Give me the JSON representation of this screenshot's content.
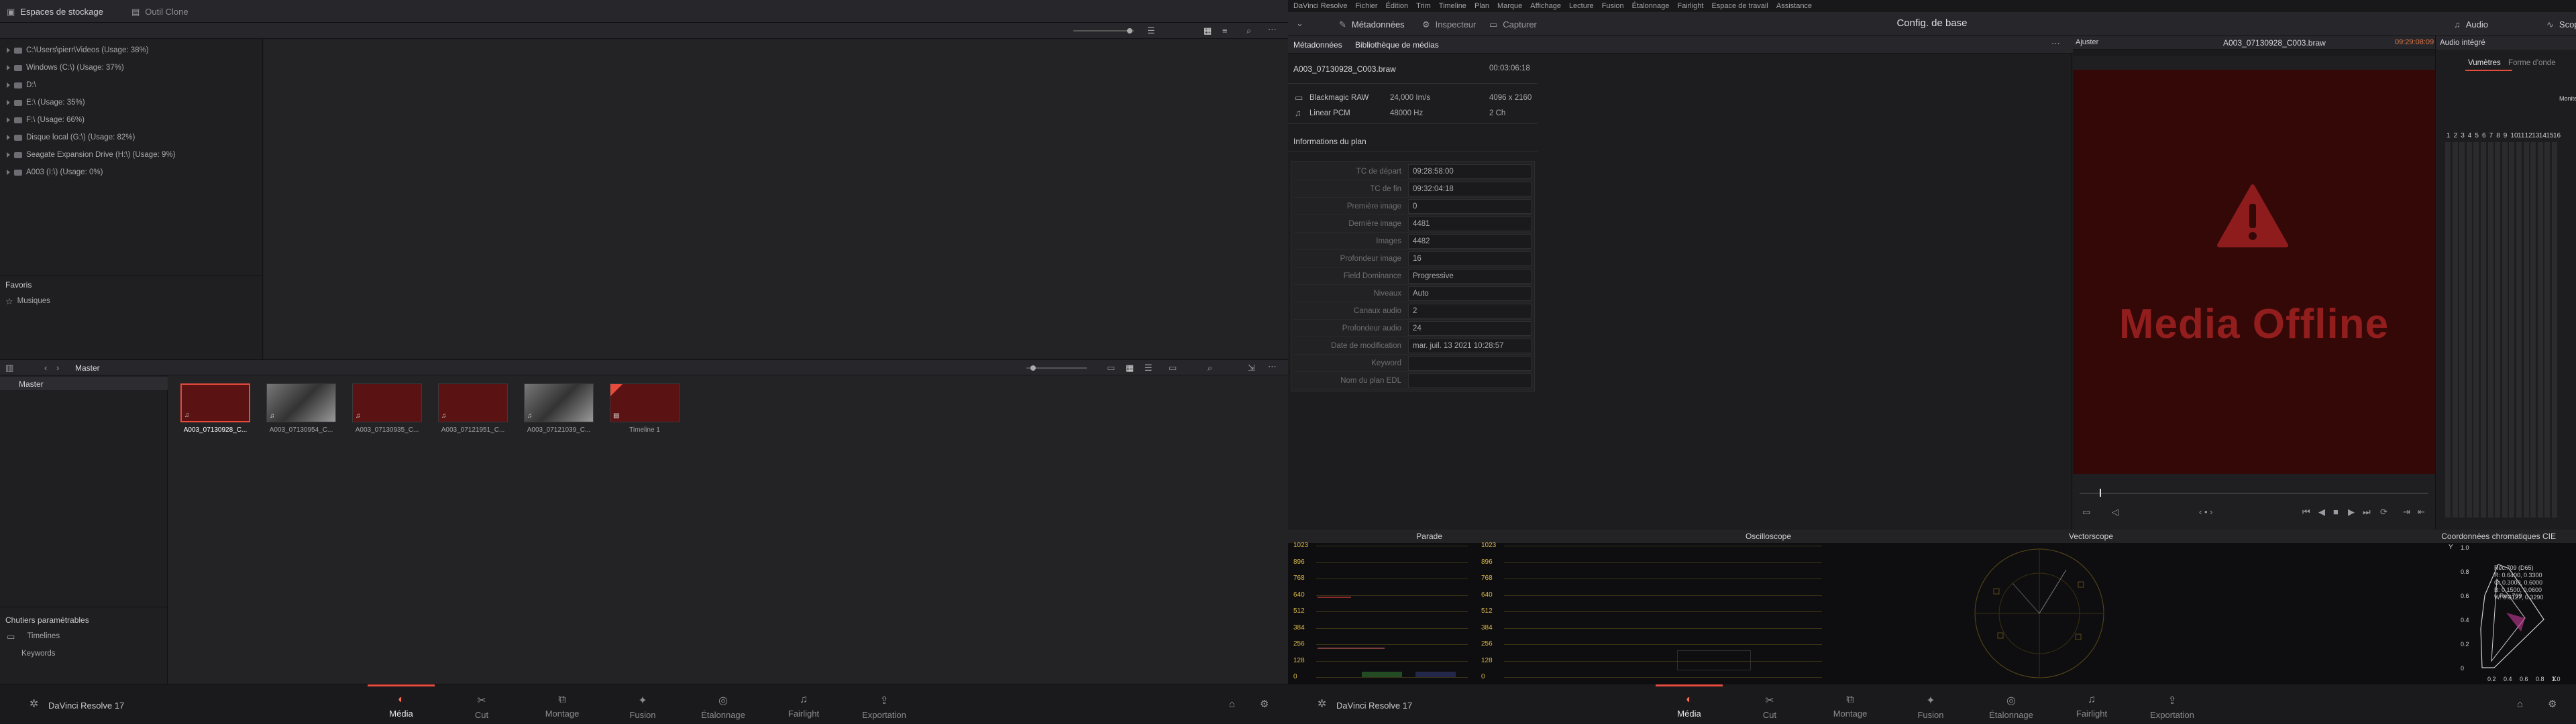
{
  "left_window": {
    "topbar": {
      "storage_tab": "Espaces de stockage",
      "clone_tab": "Outil Clone"
    },
    "storage": {
      "items": [
        "C:\\Users\\pierr\\Videos (Usage: 38%)",
        "Windows (C:\\) (Usage: 37%)",
        "D:\\",
        "E:\\ (Usage: 35%)",
        "F:\\ (Usage: 66%)",
        "Disque local (G:\\) (Usage: 82%)",
        "Seagate Expansion Drive (H:\\) (Usage: 9%)",
        "A003 (I:\\) (Usage: 0%)"
      ]
    },
    "favorites": {
      "title": "Favoris",
      "items": [
        "Musiques"
      ]
    },
    "bin": {
      "title": "Master",
      "master_label": "Master"
    },
    "clips": [
      {
        "label": "A003_07130928_C...",
        "kind": "red",
        "selected": true
      },
      {
        "label": "A003_07130954_C...",
        "kind": "gray",
        "selected": false
      },
      {
        "label": "A003_07130935_C...",
        "kind": "red",
        "selected": false
      },
      {
        "label": "A003_07121951_C...",
        "kind": "red",
        "selected": false
      },
      {
        "label": "A003_07121039_C...",
        "kind": "gray",
        "selected": false
      },
      {
        "label": "Timeline 1",
        "kind": "timeline",
        "selected": false
      }
    ],
    "smart_bins": {
      "title": "Chutiers paramétrables",
      "items": [
        "Timelines",
        "Keywords"
      ]
    },
    "app_name": "DaVinci Resolve 17",
    "pages": [
      "Média",
      "Cut",
      "Montage",
      "Fusion",
      "Étalonnage",
      "Fairlight",
      "Exportation"
    ],
    "active_page": "Média"
  },
  "right_window": {
    "menu": [
      "DaVinci Resolve",
      "Fichier",
      "Édition",
      "Trim",
      "Timeline",
      "Plan",
      "Marque",
      "Affichage",
      "Lecture",
      "Fusion",
      "Étalonnage",
      "Fairlight",
      "Espace de travail",
      "Assistance"
    ],
    "toolbar": {
      "metadata": "Métadonnées",
      "inspector": "Inspecteur",
      "capture": "Capturer",
      "title": "Config. de base",
      "audio": "Audio",
      "scopes": "Scopes"
    },
    "metadata_panel": {
      "tab_metadata": "Métadonnées",
      "tab_library": "Bibliothèque de médias",
      "clip_name": "A003_07130928_C003.braw",
      "duration": "00:03:06:18",
      "video_codec": "Blackmagic RAW",
      "fps": "24,000 Im/s",
      "resolution": "4096 x 2160",
      "audio_codec": "Linear PCM",
      "sample_rate": "48000 Hz",
      "channels": "2 Ch",
      "section": "Informations du plan",
      "fields": [
        {
          "k": "TC de départ",
          "v": "09:28:58:00"
        },
        {
          "k": "TC de fin",
          "v": "09:32:04:18"
        },
        {
          "k": "Première image",
          "v": "0"
        },
        {
          "k": "Dernière image",
          "v": "4481"
        },
        {
          "k": "Images",
          "v": "4482"
        },
        {
          "k": "Profondeur image",
          "v": "16"
        },
        {
          "k": "Field Dominance",
          "v": "Progressive"
        },
        {
          "k": "Niveaux",
          "v": "Auto"
        },
        {
          "k": "Canaux audio",
          "v": "2"
        },
        {
          "k": "Profondeur audio",
          "v": "24"
        },
        {
          "k": "Date de modification",
          "v": "mar. juil. 13 2021 10:28:57"
        },
        {
          "k": "Keyword",
          "v": ""
        },
        {
          "k": "Nom du plan EDL",
          "v": ""
        }
      ]
    },
    "viewer": {
      "fit": "Ajuster",
      "clip": "A003_07130928_C003.braw",
      "timecode": "09:29:08:09",
      "offline_text": "Media Offline"
    },
    "audio_panel": {
      "title": "Audio intégré",
      "tab_meters": "Vumètres",
      "tab_waveform": "Forme d'onde",
      "monitor": "Moniteur",
      "channels": [
        "1",
        "2",
        "3",
        "4",
        "5",
        "6",
        "7",
        "8",
        "9",
        "10",
        "11",
        "12",
        "13",
        "14",
        "15",
        "16"
      ]
    },
    "scopes": {
      "parade": "Parade",
      "waveform": "Oscilloscope",
      "vectorscope": "Vectorscope",
      "cie": "Coordonnées chromatiques CIE",
      "ticks": [
        "1023",
        "896",
        "768",
        "640",
        "512",
        "384",
        "256",
        "128",
        "0"
      ],
      "cie_info": [
        "Rec.709 (D65)",
        "R: 0.6400, 0.3300",
        "G: 0.3000, 0.6000",
        "B: 0.1500, 0.0600",
        "W: 0.3127, 0.3290"
      ],
      "cie_y_ticks": [
        "1.0",
        "0.8",
        "0.6",
        "0.4",
        "0.2",
        "0"
      ],
      "cie_x_ticks": [
        "0.2",
        "0.4",
        "0.6",
        "0.8",
        "1.0"
      ],
      "cie_label": "Rec.709",
      "cie_axis_y": "Y",
      "cie_axis_x": "X"
    },
    "app_name": "DaVinci Resolve 17",
    "pages": [
      "Média",
      "Cut",
      "Montage",
      "Fusion",
      "Étalonnage",
      "Fairlight",
      "Exportation"
    ]
  }
}
